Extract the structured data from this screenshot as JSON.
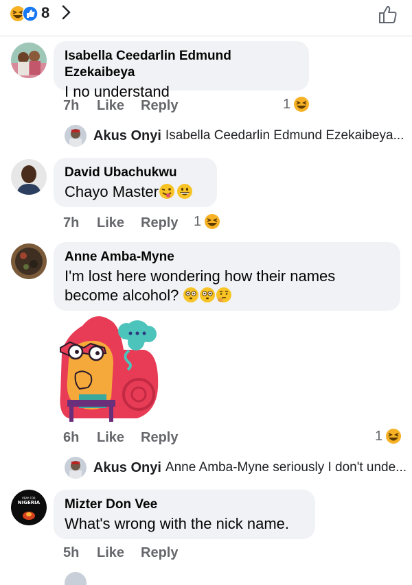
{
  "header": {
    "reaction_count": "8",
    "icons": [
      "haha-emoji-icon",
      "like-reaction-icon",
      "chevron-right-icon",
      "thumbs-up-outline-icon"
    ]
  },
  "comments": [
    {
      "author": "Isabella Ceedarlin Edmund Ezekaibeya",
      "text": "I no understand",
      "time": "7h",
      "like": "Like",
      "reply": "Reply",
      "reaction_count": "1",
      "reply_preview": {
        "name": "Akus Onyi",
        "text": "Isabella Ceedarlin Edmund Ezekaibeya..."
      }
    },
    {
      "author": "David Ubachukwu",
      "text": "Chayo Master",
      "time": "7h",
      "like": "Like",
      "reply": "Reply",
      "reaction_count": "1"
    },
    {
      "author": "Anne Amba-Myne",
      "text_line1": "I'm lost here wondering how their names",
      "text_line2": "become alcohol?",
      "time": "6h",
      "like": "Like",
      "reply": "Reply",
      "reaction_count": "1",
      "reply_preview": {
        "name": "Akus Onyi",
        "text": "Anne Amba-Myne seriously I don't unde..."
      }
    },
    {
      "author": "Mizter Don Vee",
      "text": "What's wrong with the nick name.",
      "time": "5h",
      "like": "Like",
      "reply": "Reply",
      "avatar_text_top": "PRAY FOR",
      "avatar_text": "NIGERIA"
    }
  ],
  "colors": {
    "bubble": "#f0f2f5",
    "meta": "#65676b",
    "like_blue": "#1877f2",
    "emoji_yellow": "#f7b125"
  }
}
